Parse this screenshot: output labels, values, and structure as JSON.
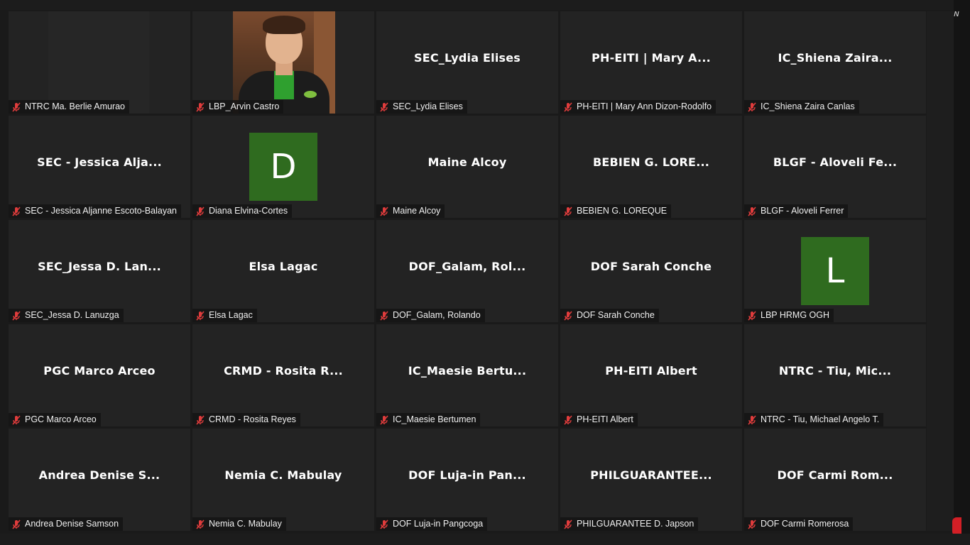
{
  "corner_label": "N",
  "tiles": [
    {
      "name": "NTRC Ma. Berlie Amurao",
      "display": "",
      "kind": "blank"
    },
    {
      "name": "LBP_Arvin Castro",
      "display": "",
      "kind": "video"
    },
    {
      "name": "SEC_Lydia Elises",
      "display": "SEC_Lydia Elises",
      "kind": "text"
    },
    {
      "name": "PH-EITI | Mary Ann Dizon-Rodolfo",
      "display": "PH-EITI | Mary A...",
      "kind": "text"
    },
    {
      "name": "IC_Shiena Zaira Canlas",
      "display": "IC_Shiena  Zaira...",
      "kind": "text"
    },
    {
      "name": "SEC - Jessica Aljanne Escoto-Balayan",
      "display": "SEC - Jessica Alja...",
      "kind": "text"
    },
    {
      "name": "Diana Elvina-Cortes",
      "display": "D",
      "kind": "avatar"
    },
    {
      "name": "Maine Alcoy",
      "display": "Maine Alcoy",
      "kind": "text"
    },
    {
      "name": "BEBIEN G. LOREQUE",
      "display": "BEBIEN G. LORE...",
      "kind": "text"
    },
    {
      "name": "BLGF - Aloveli Ferrer",
      "display": "BLGF - Aloveli Fe...",
      "kind": "text"
    },
    {
      "name": "SEC_Jessa D. Lanuzga",
      "display": "SEC_Jessa D. Lan...",
      "kind": "text"
    },
    {
      "name": "Elsa Lagac",
      "display": "Elsa Lagac",
      "kind": "text"
    },
    {
      "name": "DOF_Galam, Rolando",
      "display": "DOF_Galam,  Rol...",
      "kind": "text"
    },
    {
      "name": "DOF Sarah Conche",
      "display": "DOF Sarah Conche",
      "kind": "text"
    },
    {
      "name": "LBP HRMG OGH",
      "display": "L",
      "kind": "avatar"
    },
    {
      "name": "PGC Marco Arceo",
      "display": "PGC Marco Arceo",
      "kind": "text"
    },
    {
      "name": "CRMD - Rosita Reyes",
      "display": "CRMD - Rosita R...",
      "kind": "text"
    },
    {
      "name": "IC_Maesie Bertumen",
      "display": "IC_Maesie  Bertu...",
      "kind": "text"
    },
    {
      "name": "PH-EITI Albert",
      "display": "PH-EITI Albert",
      "kind": "text"
    },
    {
      "name": "NTRC - Tiu, Michael Angelo T.",
      "display": "NTRC - Tiu, Mic...",
      "kind": "text"
    },
    {
      "name": "Andrea Denise Samson",
      "display": "Andrea Denise S...",
      "kind": "text"
    },
    {
      "name": "Nemia C. Mabulay",
      "display": "Nemia C. Mabulay",
      "kind": "text"
    },
    {
      "name": "DOF Luja-in Pangcoga",
      "display": "DOF Luja-in Pan...",
      "kind": "text"
    },
    {
      "name": "PHILGUARANTEE D. Japson",
      "display": "PHILGUARANTEE...",
      "kind": "text"
    },
    {
      "name": "DOF Carmi Romerosa",
      "display": "DOF Carmi Rom...",
      "kind": "text"
    }
  ]
}
